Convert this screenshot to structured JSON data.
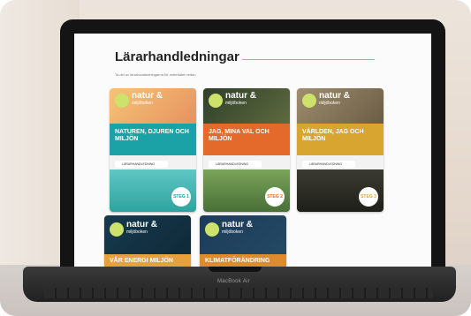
{
  "page": {
    "title": "Lärarhandledningar",
    "subtitle": "Ta del av lärarhandledningarna för materialet nedan"
  },
  "laptop": {
    "brand_label": "MacBook Air"
  },
  "cards": [
    {
      "logo_main": "natur &",
      "logo_sub": "miljöboken",
      "title": "NATUREN, DJUREN OCH MILJÖN",
      "pill": "LÄRARHANDLEDNING",
      "badge": "STEG 1",
      "accent": "#1aa2a6"
    },
    {
      "logo_main": "natur &",
      "logo_sub": "miljöboken",
      "title": "JAG, MINA VAL OCH MILJÖN",
      "pill": "LÄRARHANDLEDNING",
      "badge": "STEG 2",
      "accent": "#e46a2b"
    },
    {
      "logo_main": "natur &",
      "logo_sub": "miljöboken",
      "title": "VÄRLDEN, JAG OCH MILJÖN",
      "pill": "LÄRARHANDLEDNING",
      "badge": "STEG 3",
      "accent": "#d9a531"
    }
  ],
  "cards_row2": [
    {
      "logo_main": "natur &",
      "logo_sub": "miljöboken",
      "title": "VÅR ENERGI MILJÖN",
      "accent": "#e6a03c"
    },
    {
      "logo_main": "natur &",
      "logo_sub": "miljöboken",
      "title": "KLIMATFÖRÄNDRING",
      "accent": "#dd8b2c"
    }
  ]
}
